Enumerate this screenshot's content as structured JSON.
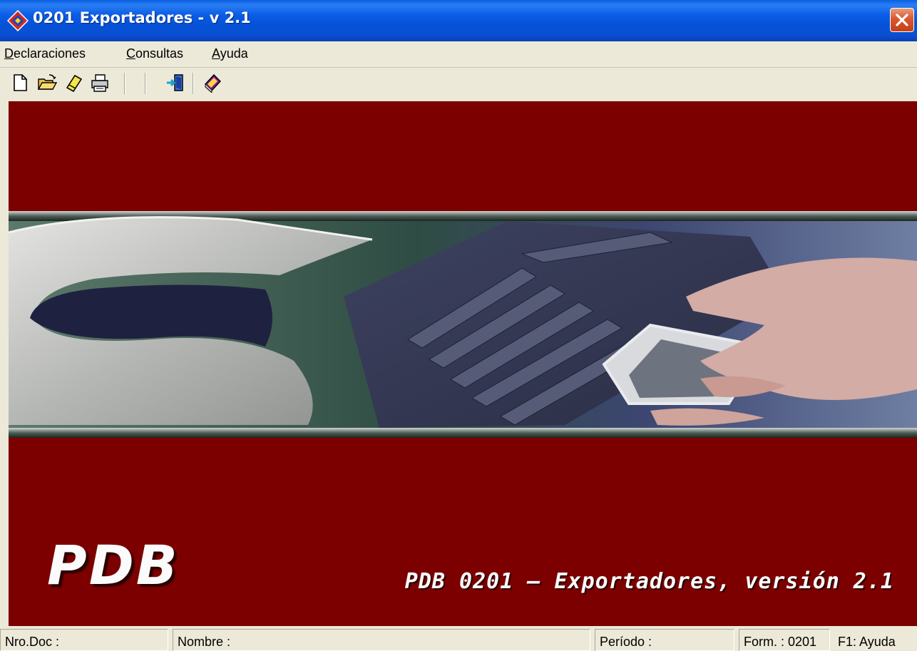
{
  "window": {
    "title": "0201 Exportadores - v 2.1",
    "app_icon": "app-diamond-icon",
    "close_icon": "close-icon"
  },
  "menu": {
    "items": [
      {
        "first": "D",
        "rest": "eclaraciones"
      },
      {
        "first": "C",
        "rest": "onsultas"
      },
      {
        "first": "A",
        "rest": "yuda"
      }
    ]
  },
  "toolbar": {
    "buttons": [
      "new-document-icon",
      "open-folder-icon",
      "eraser-icon",
      "print-icon",
      "exit-door-icon",
      "help-book-icon"
    ]
  },
  "banner": {
    "logo": "PDB",
    "subtitle": "PDB 0201 – Exportadores, versión 2.1"
  },
  "status": {
    "nro_doc": "Nro.Doc :",
    "nombre": "Nombre :",
    "periodo": "Período :",
    "form": "Form. : 0201",
    "help": "F1: Ayuda"
  },
  "colors": {
    "background_red": "#7d0000",
    "title_blue": "#0552d8"
  }
}
